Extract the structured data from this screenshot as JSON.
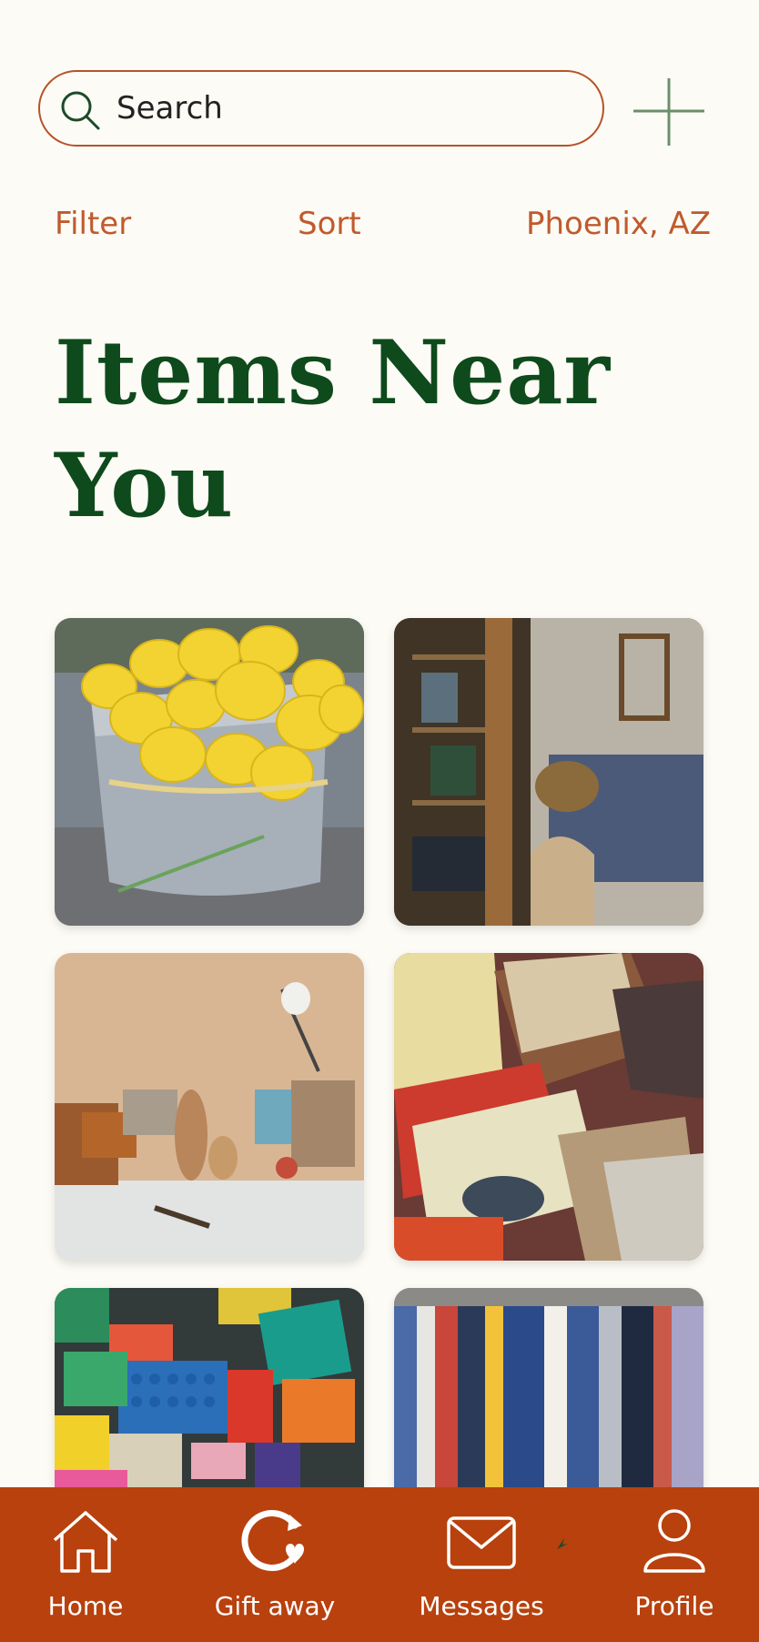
{
  "search": {
    "placeholder": "Search"
  },
  "filters": {
    "filter_label": "Filter",
    "sort_label": "Sort",
    "location": "Phoenix, AZ"
  },
  "page": {
    "title": "Items Near You"
  },
  "items": [
    {
      "subject": "lemons-in-bucket"
    },
    {
      "subject": "garage-tools-shelf"
    },
    {
      "subject": "vintage-decor-table"
    },
    {
      "subject": "vintage-magazines"
    },
    {
      "subject": "lego-bricks"
    },
    {
      "subject": "hanging-shirts"
    }
  ],
  "nav": [
    {
      "label": "Home",
      "icon": "home-icon"
    },
    {
      "label": "Gift away",
      "icon": "gift-away-icon"
    },
    {
      "label": "Messages",
      "icon": "mail-icon"
    },
    {
      "label": "Profile",
      "icon": "profile-icon"
    }
  ],
  "colors": {
    "accent": "#b8410d",
    "title_green": "#0e4a1c",
    "background": "#fdfbf5",
    "link_orange": "#c05a2d"
  }
}
